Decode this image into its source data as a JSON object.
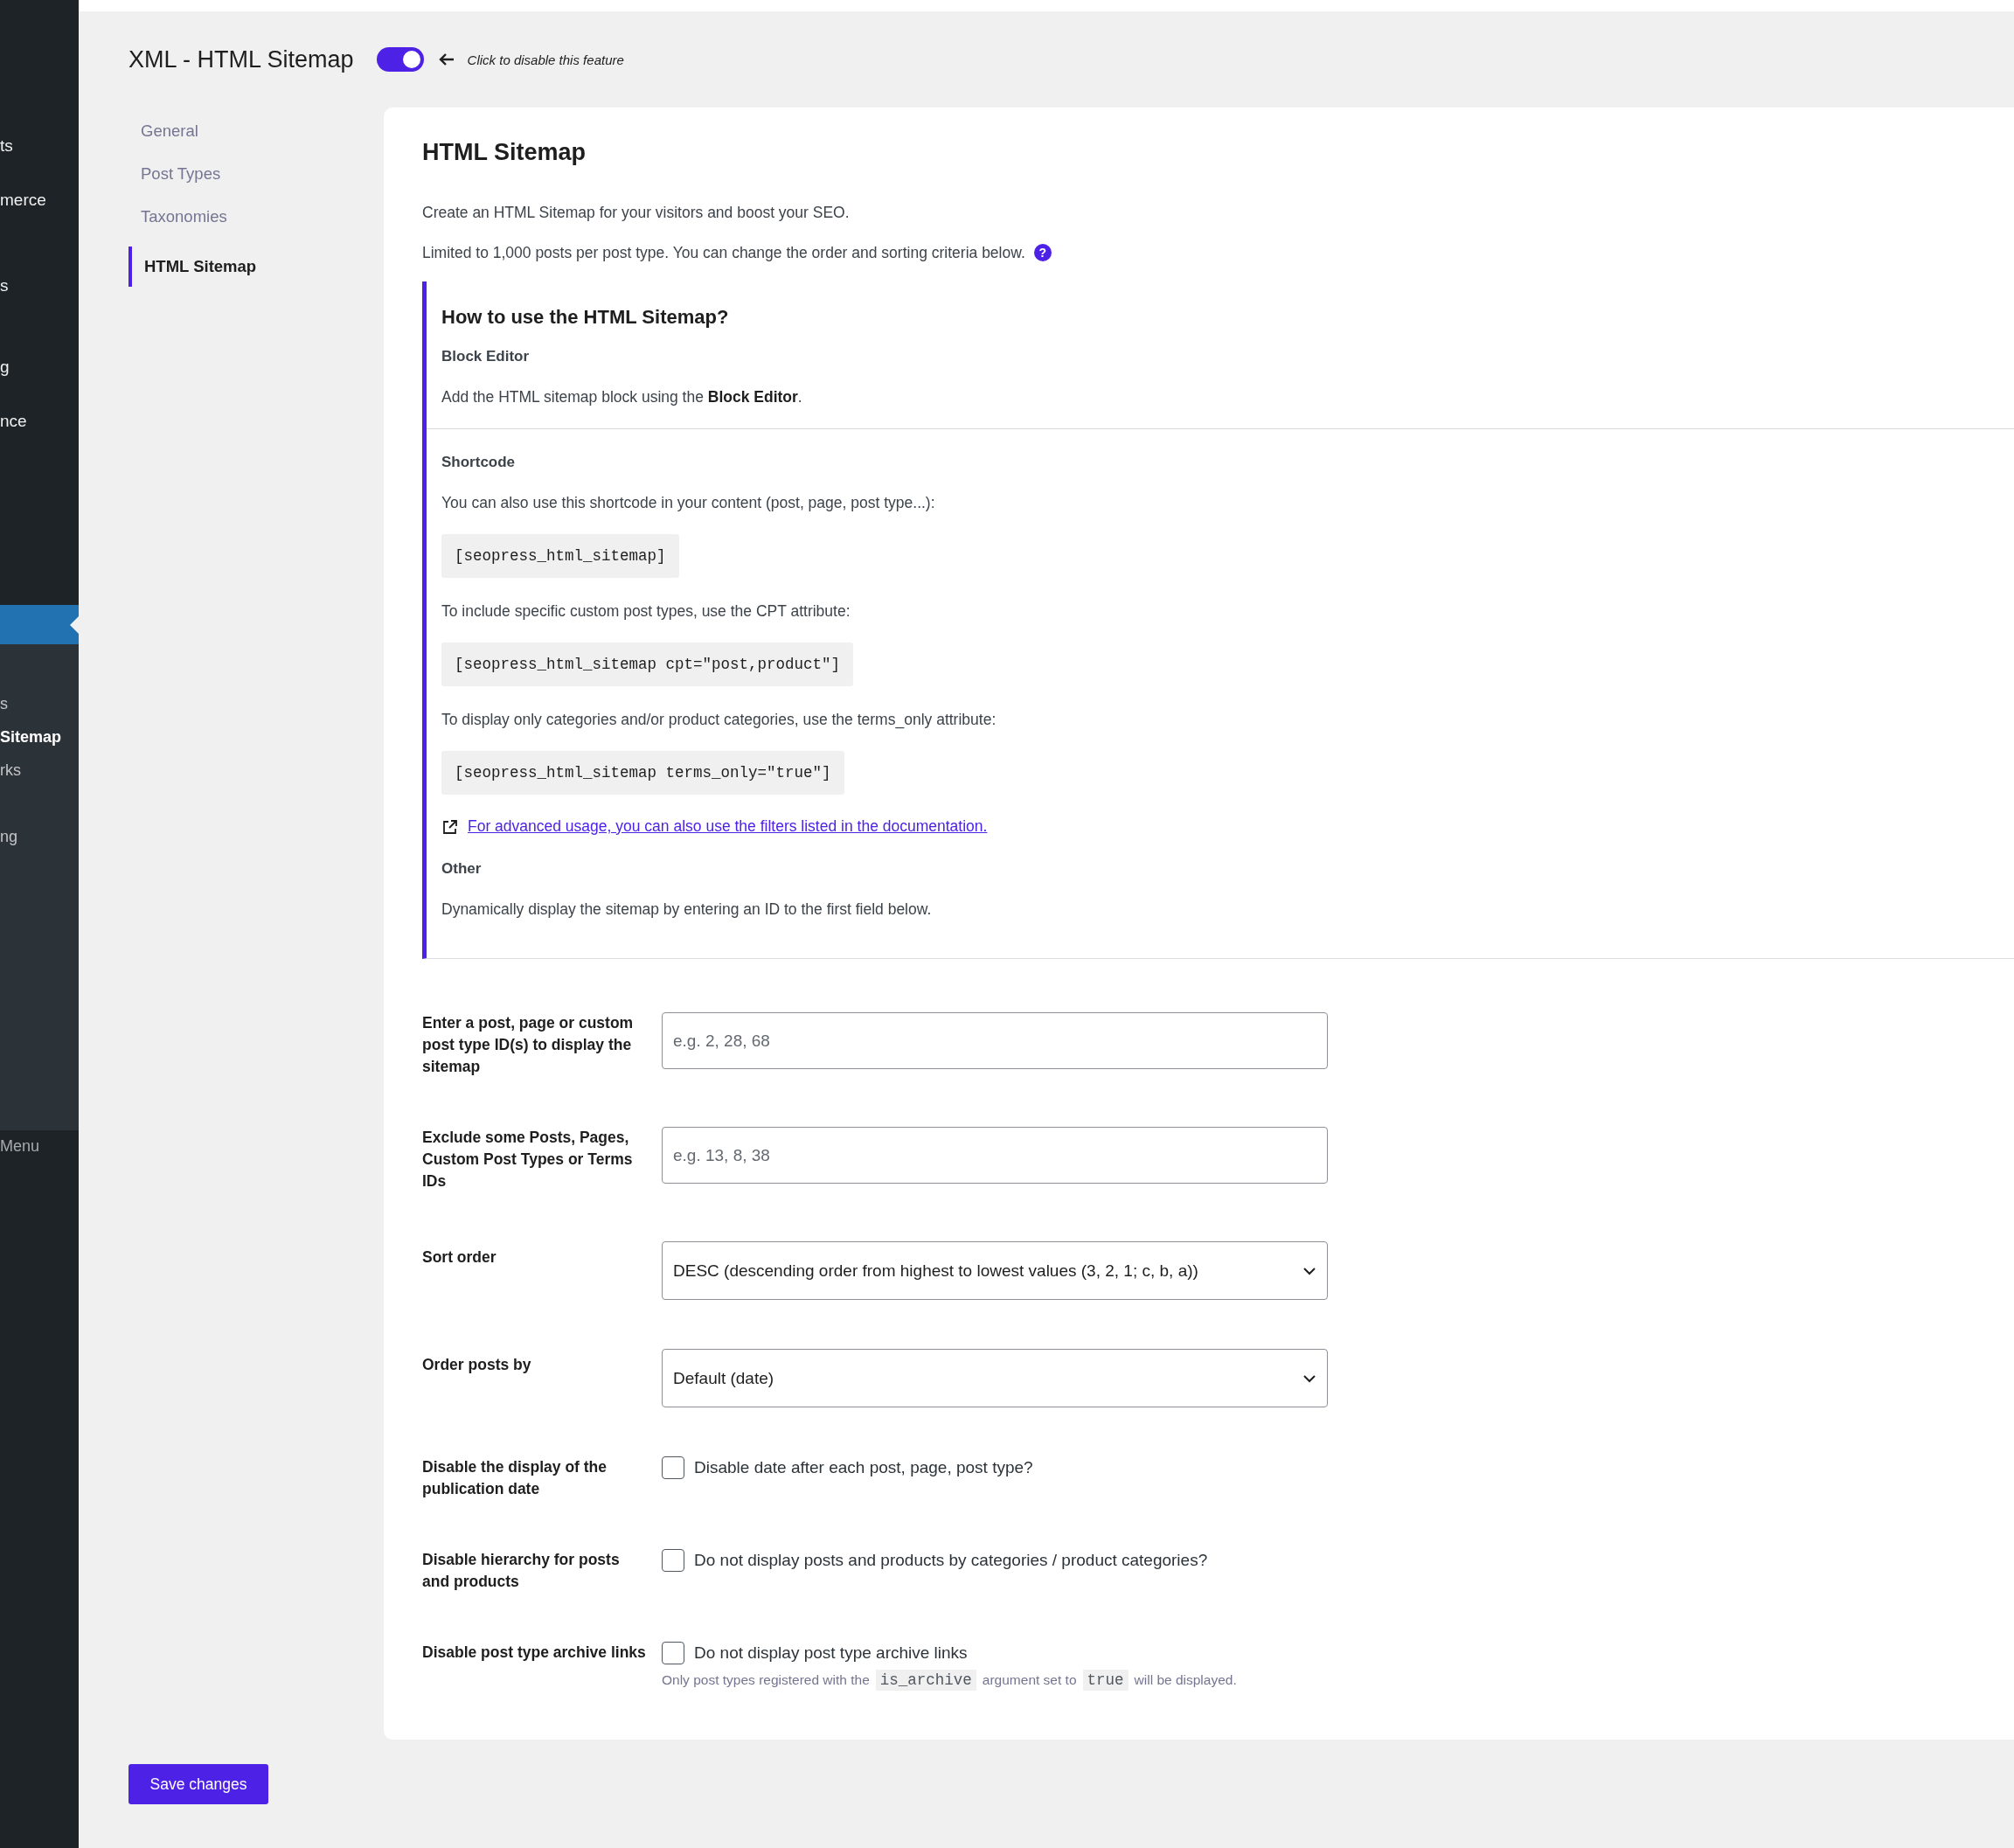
{
  "admin_menu": {
    "items": [
      {
        "label": "ts"
      },
      {
        "label": "merce"
      },
      {
        "label": "s"
      },
      {
        "label": "g"
      },
      {
        "label": "nce"
      }
    ],
    "active_item": {
      "selected": true
    },
    "submenu": [
      {
        "label": "s",
        "selected": false
      },
      {
        "label": "Sitemap",
        "selected": true
      },
      {
        "label": "rks",
        "selected": false
      },
      {
        "label": "ng",
        "selected": false
      }
    ],
    "collapse": "Menu"
  },
  "header": {
    "title": "XML - HTML Sitemap",
    "toggle": {
      "on": true
    },
    "hint": "Click to disable this feature"
  },
  "tabs": [
    {
      "label": "General",
      "selected": false
    },
    {
      "label": "Post Types",
      "selected": false
    },
    {
      "label": "Taxonomies",
      "selected": false
    },
    {
      "label": "HTML Sitemap",
      "selected": true
    }
  ],
  "panel": {
    "title": "HTML Sitemap",
    "intro": [
      "Create an HTML Sitemap for your visitors and boost your SEO.",
      "Limited to 1,000 posts per post type. You can change the order and sorting criteria below."
    ],
    "help_icon": "?",
    "howto": {
      "title": "How to use the HTML Sitemap?",
      "sections": [
        {
          "heading": "Block Editor",
          "blocks": [
            {
              "kind": "text",
              "text": "Add the HTML sitemap block using the **Block Editor**."
            }
          ]
        },
        {
          "heading": "Shortcode",
          "blocks": [
            {
              "kind": "text",
              "text": "You can also use this shortcode in your content (post, page, post type...):"
            },
            {
              "kind": "code",
              "text": "[seopress_html_sitemap]"
            },
            {
              "kind": "text",
              "text": "To include specific custom post types, use the CPT attribute:"
            },
            {
              "kind": "code",
              "text": "[seopress_html_sitemap cpt=\"post,product\"]"
            },
            {
              "kind": "text",
              "text": "To display only categories and/or product categories, use the terms_only attribute:"
            },
            {
              "kind": "code",
              "text": "[seopress_html_sitemap terms_only=\"true\"]"
            },
            {
              "kind": "link",
              "text": "For advanced usage, you can also use the filters listed in the documentation."
            }
          ]
        },
        {
          "heading": "Other",
          "blocks": [
            {
              "kind": "text",
              "text": "Dynamically display the sitemap by entering an ID to the first field below."
            }
          ]
        }
      ]
    },
    "fields": [
      {
        "kind": "input",
        "label": "Enter a post, page or custom post type ID(s) to display the sitemap",
        "placeholder": "e.g. 2, 28, 68"
      },
      {
        "kind": "input",
        "label": "Exclude some Posts, Pages, Custom Post Types or Terms IDs",
        "placeholder": "e.g. 13, 8, 38"
      },
      {
        "kind": "select",
        "label": "Sort order",
        "value": "DESC (descending order from highest to lowest values (3, 2, 1; c, b, a))"
      },
      {
        "kind": "select",
        "label": "Order posts by",
        "value": "Default (date)"
      },
      {
        "kind": "checkbox",
        "label": "Disable the display of the publication date",
        "option": "Disable date after each post, page, post type?",
        "checked": false
      },
      {
        "kind": "checkbox",
        "label": "Disable hierarchy for posts and products",
        "option": "Do not display posts and products by categories / product categories?",
        "checked": false
      },
      {
        "kind": "checkbox",
        "label": "Disable post type archive links",
        "option": "Do not display post type archive links",
        "checked": false,
        "help": [
          {
            "kind": "text",
            "text": "Only post types registered with the"
          },
          {
            "kind": "code",
            "text": "is_archive"
          },
          {
            "kind": "text",
            "text": "argument set to"
          },
          {
            "kind": "code",
            "text": "true"
          },
          {
            "kind": "text",
            "text": "will be displayed."
          }
        ]
      }
    ]
  },
  "save_button": "Save changes"
}
